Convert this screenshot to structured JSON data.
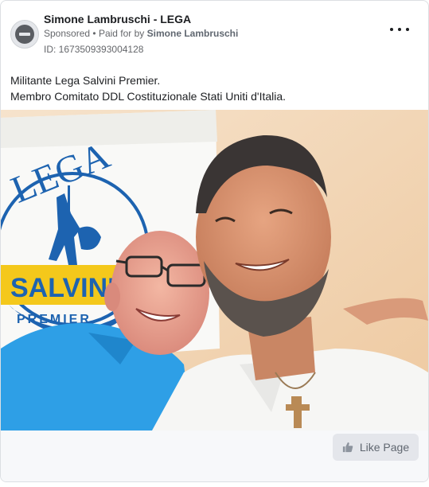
{
  "post": {
    "page_name": "Simone Lambruschi - LEGA",
    "sponsored_label": "Sponsored",
    "separator": "•",
    "paid_for_label": "Paid for by",
    "paid_for_name": "Simone Lambruschi",
    "ad_id": "ID: 1673509393004128",
    "more_options_icon": "more-horizontal-icon",
    "body_lines": [
      "Militante Lega Salvini Premier.",
      "Membro Comitato DDL Costituzionale Stati Uniti d'Italia."
    ],
    "image": {
      "flag_text_top": "LEGA",
      "flag_text_main": "SALVINI",
      "flag_text_sub": "PREMIER"
    }
  },
  "footer": {
    "like_button_label": "Like Page",
    "like_icon": "thumbs-up-icon"
  },
  "colors": {
    "lega_blue": "#1d63b0",
    "lega_yellow": "#f4c81b",
    "button_bg": "#e4e6eb",
    "footer_bg": "#f7f8fa"
  }
}
